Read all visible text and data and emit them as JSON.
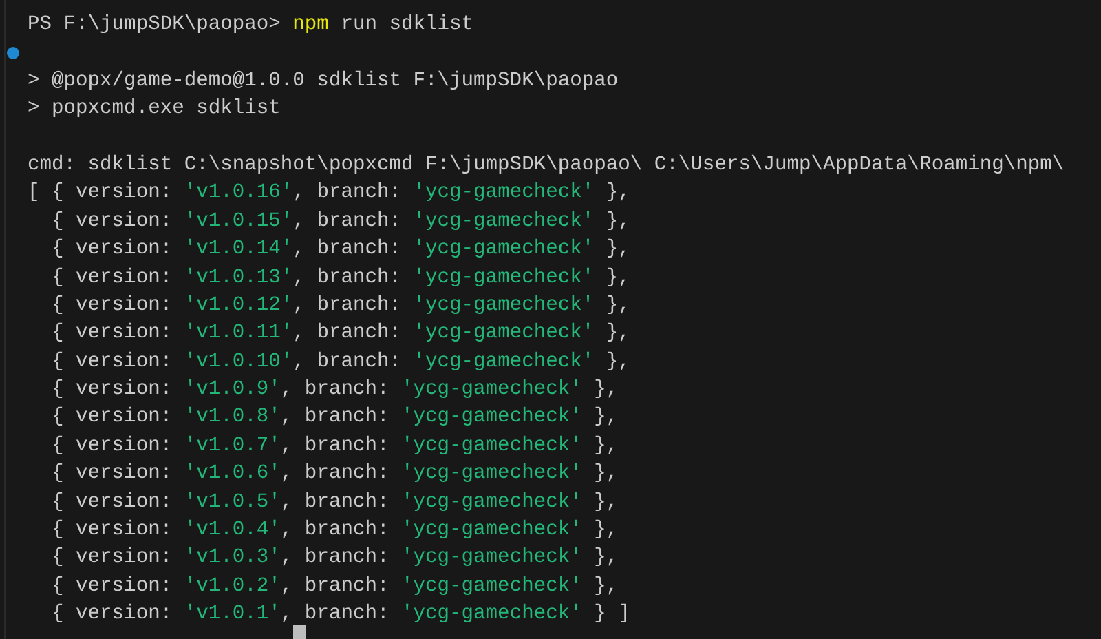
{
  "terminal": {
    "lines": [
      {
        "kind": "text",
        "segments": [
          {
            "kind": "plain",
            "text": "PS F:\\jumpSDK\\paopao> "
          },
          {
            "kind": "command",
            "text": "npm"
          },
          {
            "kind": "plain",
            "text": " run sdklist"
          }
        ]
      },
      {
        "kind": "blank"
      },
      {
        "kind": "text",
        "segments": [
          {
            "kind": "plain",
            "text": "> @popx/game-demo@1.0.0 sdklist F:\\jumpSDK\\paopao"
          }
        ]
      },
      {
        "kind": "text",
        "segments": [
          {
            "kind": "plain",
            "text": "> popxcmd.exe sdklist"
          }
        ]
      },
      {
        "kind": "blank"
      },
      {
        "kind": "text",
        "segments": [
          {
            "kind": "plain",
            "text": "cmd: sdklist C:\\snapshot\\popxcmd F:\\jumpSDK\\paopao\\ C:\\Users\\Jump\\AppData\\Roaming\\npm\\"
          }
        ]
      },
      {
        "kind": "text",
        "segments": [
          {
            "kind": "plain",
            "text": "[ { version: "
          },
          {
            "kind": "string",
            "text": "'v1.0.16'"
          },
          {
            "kind": "plain",
            "text": ", branch: "
          },
          {
            "kind": "string",
            "text": "'ycg-gamecheck'"
          },
          {
            "kind": "plain",
            "text": " },"
          }
        ]
      },
      {
        "kind": "text",
        "segments": [
          {
            "kind": "plain",
            "text": "  { version: "
          },
          {
            "kind": "string",
            "text": "'v1.0.15'"
          },
          {
            "kind": "plain",
            "text": ", branch: "
          },
          {
            "kind": "string",
            "text": "'ycg-gamecheck'"
          },
          {
            "kind": "plain",
            "text": " },"
          }
        ]
      },
      {
        "kind": "text",
        "segments": [
          {
            "kind": "plain",
            "text": "  { version: "
          },
          {
            "kind": "string",
            "text": "'v1.0.14'"
          },
          {
            "kind": "plain",
            "text": ", branch: "
          },
          {
            "kind": "string",
            "text": "'ycg-gamecheck'"
          },
          {
            "kind": "plain",
            "text": " },"
          }
        ]
      },
      {
        "kind": "text",
        "segments": [
          {
            "kind": "plain",
            "text": "  { version: "
          },
          {
            "kind": "string",
            "text": "'v1.0.13'"
          },
          {
            "kind": "plain",
            "text": ", branch: "
          },
          {
            "kind": "string",
            "text": "'ycg-gamecheck'"
          },
          {
            "kind": "plain",
            "text": " },"
          }
        ]
      },
      {
        "kind": "text",
        "segments": [
          {
            "kind": "plain",
            "text": "  { version: "
          },
          {
            "kind": "string",
            "text": "'v1.0.12'"
          },
          {
            "kind": "plain",
            "text": ", branch: "
          },
          {
            "kind": "string",
            "text": "'ycg-gamecheck'"
          },
          {
            "kind": "plain",
            "text": " },"
          }
        ]
      },
      {
        "kind": "text",
        "segments": [
          {
            "kind": "plain",
            "text": "  { version: "
          },
          {
            "kind": "string",
            "text": "'v1.0.11'"
          },
          {
            "kind": "plain",
            "text": ", branch: "
          },
          {
            "kind": "string",
            "text": "'ycg-gamecheck'"
          },
          {
            "kind": "plain",
            "text": " },"
          }
        ]
      },
      {
        "kind": "text",
        "segments": [
          {
            "kind": "plain",
            "text": "  { version: "
          },
          {
            "kind": "string",
            "text": "'v1.0.10'"
          },
          {
            "kind": "plain",
            "text": ", branch: "
          },
          {
            "kind": "string",
            "text": "'ycg-gamecheck'"
          },
          {
            "kind": "plain",
            "text": " },"
          }
        ]
      },
      {
        "kind": "text",
        "segments": [
          {
            "kind": "plain",
            "text": "  { version: "
          },
          {
            "kind": "string",
            "text": "'v1.0.9'"
          },
          {
            "kind": "plain",
            "text": ", branch: "
          },
          {
            "kind": "string",
            "text": "'ycg-gamecheck'"
          },
          {
            "kind": "plain",
            "text": " },"
          }
        ]
      },
      {
        "kind": "text",
        "segments": [
          {
            "kind": "plain",
            "text": "  { version: "
          },
          {
            "kind": "string",
            "text": "'v1.0.8'"
          },
          {
            "kind": "plain",
            "text": ", branch: "
          },
          {
            "kind": "string",
            "text": "'ycg-gamecheck'"
          },
          {
            "kind": "plain",
            "text": " },"
          }
        ]
      },
      {
        "kind": "text",
        "segments": [
          {
            "kind": "plain",
            "text": "  { version: "
          },
          {
            "kind": "string",
            "text": "'v1.0.7'"
          },
          {
            "kind": "plain",
            "text": ", branch: "
          },
          {
            "kind": "string",
            "text": "'ycg-gamecheck'"
          },
          {
            "kind": "plain",
            "text": " },"
          }
        ]
      },
      {
        "kind": "text",
        "segments": [
          {
            "kind": "plain",
            "text": "  { version: "
          },
          {
            "kind": "string",
            "text": "'v1.0.6'"
          },
          {
            "kind": "plain",
            "text": ", branch: "
          },
          {
            "kind": "string",
            "text": "'ycg-gamecheck'"
          },
          {
            "kind": "plain",
            "text": " },"
          }
        ]
      },
      {
        "kind": "text",
        "segments": [
          {
            "kind": "plain",
            "text": "  { version: "
          },
          {
            "kind": "string",
            "text": "'v1.0.5'"
          },
          {
            "kind": "plain",
            "text": ", branch: "
          },
          {
            "kind": "string",
            "text": "'ycg-gamecheck'"
          },
          {
            "kind": "plain",
            "text": " },"
          }
        ]
      },
      {
        "kind": "text",
        "segments": [
          {
            "kind": "plain",
            "text": "  { version: "
          },
          {
            "kind": "string",
            "text": "'v1.0.4'"
          },
          {
            "kind": "plain",
            "text": ", branch: "
          },
          {
            "kind": "string",
            "text": "'ycg-gamecheck'"
          },
          {
            "kind": "plain",
            "text": " },"
          }
        ]
      },
      {
        "kind": "text",
        "segments": [
          {
            "kind": "plain",
            "text": "  { version: "
          },
          {
            "kind": "string",
            "text": "'v1.0.3'"
          },
          {
            "kind": "plain",
            "text": ", branch: "
          },
          {
            "kind": "string",
            "text": "'ycg-gamecheck'"
          },
          {
            "kind": "plain",
            "text": " },"
          }
        ]
      },
      {
        "kind": "text",
        "segments": [
          {
            "kind": "plain",
            "text": "  { version: "
          },
          {
            "kind": "string",
            "text": "'v1.0.2'"
          },
          {
            "kind": "plain",
            "text": ", branch: "
          },
          {
            "kind": "string",
            "text": "'ycg-gamecheck'"
          },
          {
            "kind": "plain",
            "text": " },"
          }
        ]
      },
      {
        "kind": "text",
        "segments": [
          {
            "kind": "plain",
            "text": "  { version: "
          },
          {
            "kind": "string",
            "text": "'v1.0.1'"
          },
          {
            "kind": "plain",
            "text": ", branch: "
          },
          {
            "kind": "string",
            "text": "'ycg-gamecheck'"
          },
          {
            "kind": "plain",
            "text": " } ]"
          }
        ]
      }
    ]
  }
}
